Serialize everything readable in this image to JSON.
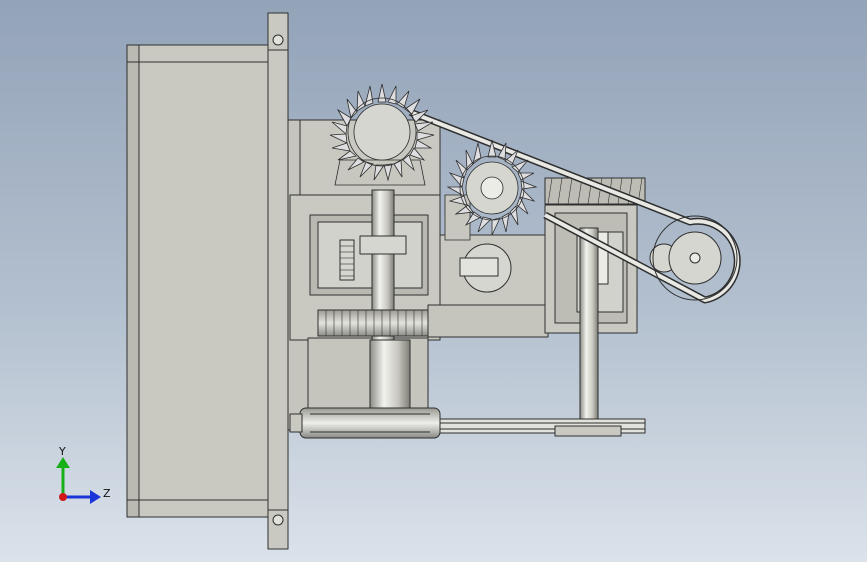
{
  "triad": {
    "y_label": "Y",
    "z_label": "Z",
    "y_color": "#18b018",
    "z_color": "#1a34d8",
    "origin_color": "#d01818"
  },
  "colors": {
    "part_fill": "#c9c9c1",
    "part_fill_dark": "#a9a9a1",
    "edge": "#2e2e2e",
    "gear_fill": "#d6d6d0",
    "background_top": "#93a3b8",
    "background_bottom": "#dbe2ea"
  }
}
